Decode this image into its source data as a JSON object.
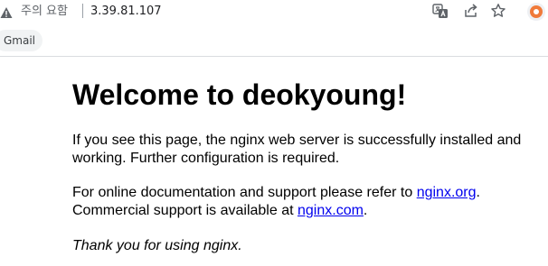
{
  "browser": {
    "security_label": "주의 요함",
    "url": "3.39.81.107",
    "icons": [
      "warning-icon",
      "translate-icon",
      "share-icon",
      "bookmark-star-icon",
      "extension-icon"
    ]
  },
  "bookmarks_bar": {
    "items": [
      {
        "label": "Gmail"
      }
    ]
  },
  "page": {
    "heading": "Welcome to deokyoung!",
    "para1": "If you see this page, the nginx web server is successfully installed and working. Further configuration is required.",
    "para2_before": "For online documentation and support please refer to ",
    "link1": "nginx.org",
    "para2_mid": ".",
    "para2_line2": "Commercial support is available at ",
    "link2": "nginx.com",
    "para2_end": ".",
    "thanks": "Thank you for using nginx."
  },
  "colors": {
    "link": "#0000ee",
    "text": "#000000",
    "chrome_text": "#5f6368",
    "extension_accent": "#f07a3a"
  }
}
